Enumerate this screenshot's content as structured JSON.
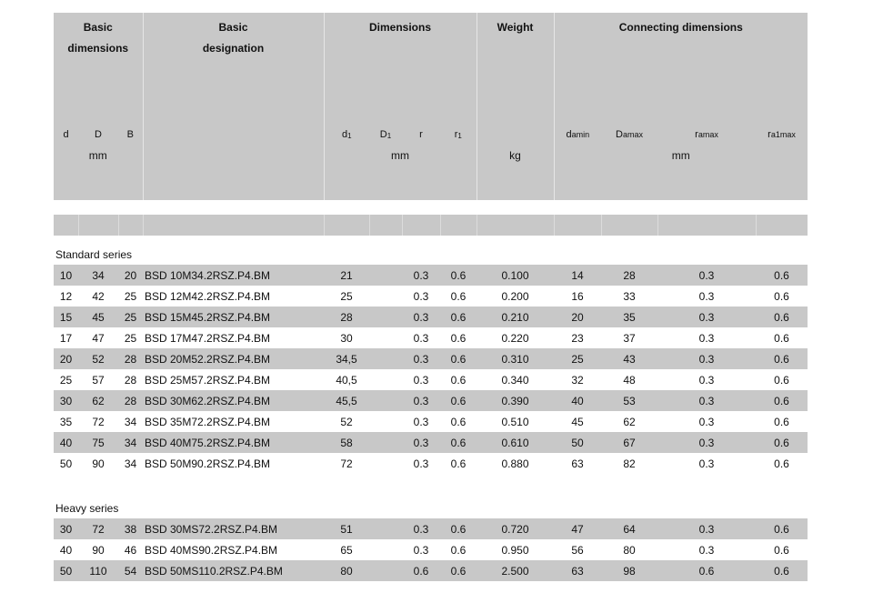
{
  "header": {
    "groups": {
      "basic_dimensions": [
        "Basic",
        "dimensions"
      ],
      "basic_designation": [
        "Basic",
        "designation"
      ],
      "dimensions": "Dimensions",
      "weight": "Weight",
      "connecting_dimensions": "Connecting dimensions"
    },
    "symbols": {
      "d": "d",
      "D": "D",
      "B": "B",
      "d1": "d",
      "d1_sub": "1",
      "D1": "D",
      "D1_sub": "1",
      "r": "r",
      "r1": "r",
      "r1_sub": "1",
      "damin": "d",
      "damin_sub": "amin",
      "Damax": "D",
      "Damax_sub": "amax",
      "ramax": "r",
      "ramax_sub": "amax",
      "ra1max": "r",
      "ra1max_sub": "a1max"
    },
    "units": {
      "basic": "mm",
      "dimensions": "mm",
      "weight": "kg",
      "connecting": "mm"
    }
  },
  "sections": [
    {
      "title": "Standard series",
      "rows": [
        {
          "d": "10",
          "D": "34",
          "B": "20",
          "designation": "BSD 10M34.2RSZ.P4.BM",
          "d1": "21",
          "D1": "",
          "r": "0.3",
          "r1": "0.6",
          "weight": "0.100",
          "damin": "14",
          "Damax": "28",
          "ramax": "0.3",
          "ra1max": "0.6"
        },
        {
          "d": "12",
          "D": "42",
          "B": "25",
          "designation": "BSD 12M42.2RSZ.P4.BM",
          "d1": "25",
          "D1": "",
          "r": "0.3",
          "r1": "0.6",
          "weight": "0.200",
          "damin": "16",
          "Damax": "33",
          "ramax": "0.3",
          "ra1max": "0.6"
        },
        {
          "d": "15",
          "D": "45",
          "B": "25",
          "designation": "BSD 15M45.2RSZ.P4.BM",
          "d1": "28",
          "D1": "",
          "r": "0.3",
          "r1": "0.6",
          "weight": "0.210",
          "damin": "20",
          "Damax": "35",
          "ramax": "0.3",
          "ra1max": "0.6"
        },
        {
          "d": "17",
          "D": "47",
          "B": "25",
          "designation": "BSD 17M47.2RSZ.P4.BM",
          "d1": "30",
          "D1": "",
          "r": "0.3",
          "r1": "0.6",
          "weight": "0.220",
          "damin": "23",
          "Damax": "37",
          "ramax": "0.3",
          "ra1max": "0.6"
        },
        {
          "d": "20",
          "D": "52",
          "B": "28",
          "designation": "BSD 20M52.2RSZ.P4.BM",
          "d1": "34,5",
          "D1": "",
          "r": "0.3",
          "r1": "0.6",
          "weight": "0.310",
          "damin": "25",
          "Damax": "43",
          "ramax": "0.3",
          "ra1max": "0.6"
        },
        {
          "d": "25",
          "D": "57",
          "B": "28",
          "designation": "BSD 25M57.2RSZ.P4.BM",
          "d1": "40,5",
          "D1": "",
          "r": "0.3",
          "r1": "0.6",
          "weight": "0.340",
          "damin": "32",
          "Damax": "48",
          "ramax": "0.3",
          "ra1max": "0.6"
        },
        {
          "d": "30",
          "D": "62",
          "B": "28",
          "designation": "BSD 30M62.2RSZ.P4.BM",
          "d1": "45,5",
          "D1": "",
          "r": "0.3",
          "r1": "0.6",
          "weight": "0.390",
          "damin": "40",
          "Damax": "53",
          "ramax": "0.3",
          "ra1max": "0.6"
        },
        {
          "d": "35",
          "D": "72",
          "B": "34",
          "designation": "BSD 35M72.2RSZ.P4.BM",
          "d1": "52",
          "D1": "",
          "r": "0.3",
          "r1": "0.6",
          "weight": "0.510",
          "damin": "45",
          "Damax": "62",
          "ramax": "0.3",
          "ra1max": "0.6"
        },
        {
          "d": "40",
          "D": "75",
          "B": "34",
          "designation": "BSD 40M75.2RSZ.P4.BM",
          "d1": "58",
          "D1": "",
          "r": "0.3",
          "r1": "0.6",
          "weight": "0.610",
          "damin": "50",
          "Damax": "67",
          "ramax": "0.3",
          "ra1max": "0.6"
        },
        {
          "d": "50",
          "D": "90",
          "B": "34",
          "designation": "BSD 50M90.2RSZ.P4.BM",
          "d1": "72",
          "D1": "",
          "r": "0.3",
          "r1": "0.6",
          "weight": "0.880",
          "damin": "63",
          "Damax": "82",
          "ramax": "0.3",
          "ra1max": "0.6"
        }
      ]
    },
    {
      "title": "Heavy series",
      "rows": [
        {
          "d": "30",
          "D": "72",
          "B": "38",
          "designation": "BSD 30MS72.2RSZ.P4.BM",
          "d1": "51",
          "D1": "",
          "r": "0.3",
          "r1": "0.6",
          "weight": "0.720",
          "damin": "47",
          "Damax": "64",
          "ramax": "0.3",
          "ra1max": "0.6"
        },
        {
          "d": "40",
          "D": "90",
          "B": "46",
          "designation": "BSD 40MS90.2RSZ.P4.BM",
          "d1": "65",
          "D1": "",
          "r": "0.3",
          "r1": "0.6",
          "weight": "0.950",
          "damin": "56",
          "Damax": "80",
          "ramax": "0.3",
          "ra1max": "0.6"
        },
        {
          "d": "50",
          "D": "110",
          "B": "54",
          "designation": "BSD 50MS110.2RSZ.P4.BM",
          "d1": "80",
          "D1": "",
          "r": "0.6",
          "r1": "0.6",
          "weight": "2.500",
          "damin": "63",
          "Damax": "98",
          "ramax": "0.6",
          "ra1max": "0.6"
        }
      ]
    }
  ]
}
